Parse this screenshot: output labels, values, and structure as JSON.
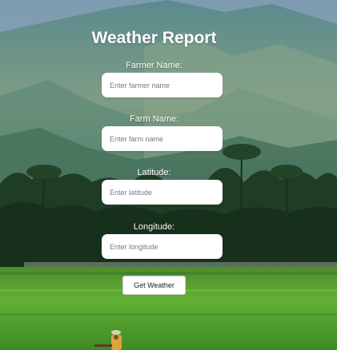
{
  "page": {
    "title": "Weather Report"
  },
  "form": {
    "farmer_name": {
      "label": "Farmer Name:",
      "placeholder": "Enter farmer name",
      "value": ""
    },
    "farm_name": {
      "label": "Farm Name:",
      "placeholder": "Enter farm name",
      "value": ""
    },
    "latitude": {
      "label": "Latitude:",
      "placeholder": "Enter latitude",
      "value": ""
    },
    "longitude": {
      "label": "Longitude:",
      "placeholder": "Enter longitude",
      "value": ""
    },
    "submit_label": "Get Weather"
  },
  "background": {
    "icon": "landscape-photo",
    "colors": {
      "sky": "#6f8fa6",
      "mountain": "#3f6a7a",
      "mountain_light": "#7f9a84",
      "trees": "#1e3a22",
      "field": "#4d9a2a",
      "field_light": "#6fbf3a"
    }
  }
}
